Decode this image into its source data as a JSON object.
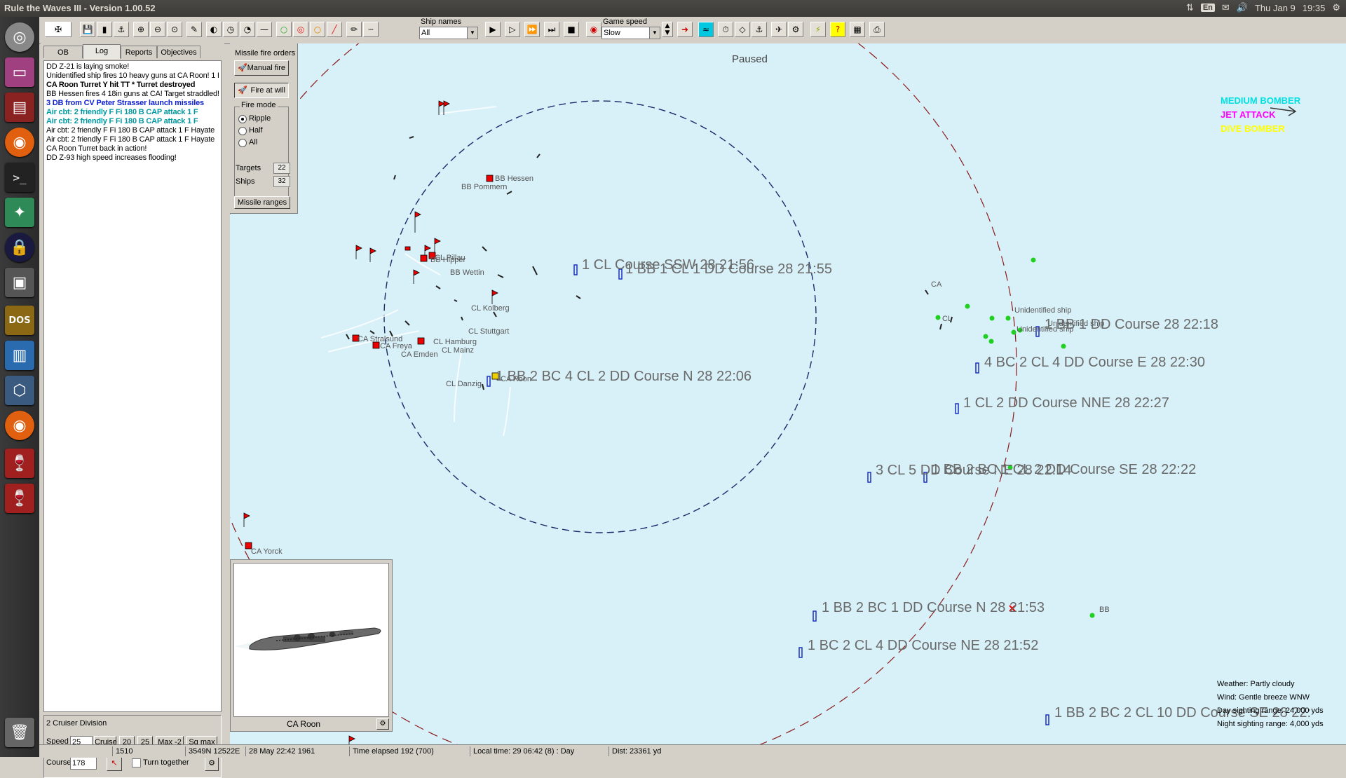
{
  "window": {
    "title": "Rule the Waves III - Version 1.00.52"
  },
  "tray": {
    "keyboard": "En",
    "datetime": "Thu Jan 9",
    "clock": "19:35"
  },
  "toolbar": {
    "ship_names_label": "Ship names",
    "ship_names_value": "All",
    "game_speed_label": "Game speed",
    "game_speed_value": "Slow"
  },
  "tabs": [
    "OB",
    "Log",
    "Reports",
    "Objectives"
  ],
  "log": [
    {
      "text": "DD Z-21 is laying smoke!",
      "style": "normal"
    },
    {
      "text": "Unidentified ship fires 10 heavy guns at CA Roon! 1 H",
      "style": "normal"
    },
    {
      "text": "CA Roon Turret Y hit TT * Turret destroyed",
      "style": "bold"
    },
    {
      "text": "BB Hessen fires 4 18in guns at CA! Target straddled!",
      "style": "normal"
    },
    {
      "text": "3 DB from CV Peter Strasser launch missiles",
      "style": "blue"
    },
    {
      "text": "Air cbt: 2  friendly F Fi 180 B CAP attack 1 F",
      "style": "teal"
    },
    {
      "text": "Air cbt: 2  friendly F Fi 180 B CAP attack 1 F",
      "style": "teal"
    },
    {
      "text": "Air cbt: 2  friendly F Fi 180 B CAP attack 1 F Hayate",
      "style": "normal"
    },
    {
      "text": "Air cbt: 2  friendly F Fi 180 B CAP attack 1 F Hayate",
      "style": "normal"
    },
    {
      "text": "CA Roon Turret back in action!",
      "style": "normal"
    },
    {
      "text": "DD Z-93 high speed increases flooding!",
      "style": "normal"
    }
  ],
  "division": {
    "name": "2 Cruiser Division",
    "speed_label": "Speed",
    "speed_value": "25",
    "cruise_label": "Cruise",
    "btn_20": "20",
    "btn_25": "25",
    "max2_label": "Max -2",
    "sqmax_label": "Sq max",
    "course_label": "Course",
    "course_value": "178",
    "turn_together": "Turn together"
  },
  "missile": {
    "title": "Missile fire orders",
    "manual_fire": "Manual fire",
    "fire_at_will": "Fire at will",
    "fire_mode_label": "Fire mode",
    "modes": [
      "Ripple",
      "Half",
      "All"
    ],
    "selected_mode": "Ripple",
    "targets_label": "Targets",
    "targets_value": "22",
    "ships_label": "Ships",
    "ships_value": "32",
    "ranges_button": "Missile ranges"
  },
  "shipview": {
    "name": "CA Roon"
  },
  "map": {
    "paused": "Paused",
    "legend": [
      {
        "text": "MEDIUM BOMBER",
        "color": "#00e0e0"
      },
      {
        "text": "JET ATTACK",
        "color": "#ff00ff"
      },
      {
        "text": "DIVE BOMBER",
        "color": "#ffff00"
      }
    ],
    "weather": "Weather: Partly cloudy",
    "wind": "Wind: Gentle breeze  WNW",
    "day_sighting": "Day sighting range: 24,000 yds",
    "night_sighting": "Night sighting range: 4,000 yds",
    "ship_labels": [
      "BB Hessen",
      "BB Pommern",
      "CL Pillau",
      "BB Hipper",
      "BB Wettin",
      "CL Kolberg",
      "CL Stuttgart",
      "CA Stralsund",
      "CA Freya",
      "CA Emden",
      "CL Hamburg",
      "CL Mainz",
      "CL Danzig",
      "CA Roon",
      "CA Yorck"
    ],
    "enemy_labels": [
      "CA",
      "CL",
      "Unidentified ship",
      "Unidentified ship",
      "Unidentified ship",
      "BB"
    ],
    "contacts": [
      "1 CL Course SSW 28 21:56",
      "1 BB 1 CL 1 DD Course  28 21:55",
      "1 BB 2 BC 4 CL 2 DD Course N 28 22:06",
      "1 BB 1 DD Course  28 22:18",
      "4 BC 2 CL 4 DD Course E 28 22:30",
      "1 CL 2 DD Course NNE 28 22:27",
      "3 CL 5 DD Course NE 28 22:14",
      "1 BB 2 BC 1 CL 2 DD Course SE 28 22:22",
      "1 BB 2 BC 1 DD Course N 28 21:53",
      "1 BC 2 CL 4 DD Course NE 28 21:52",
      "1 BB 2 BC 2 CL 10 DD Course SE 28 22:"
    ]
  },
  "statusbar": {
    "turn": "1510",
    "position": "3549N 12522E",
    "date": "28 May 22:42 1961",
    "elapsed": "Time elapsed 192 (700)",
    "local_time": "Local time: 29 06:42 (8) : Day",
    "dist": "Dist: 23361 yd"
  }
}
